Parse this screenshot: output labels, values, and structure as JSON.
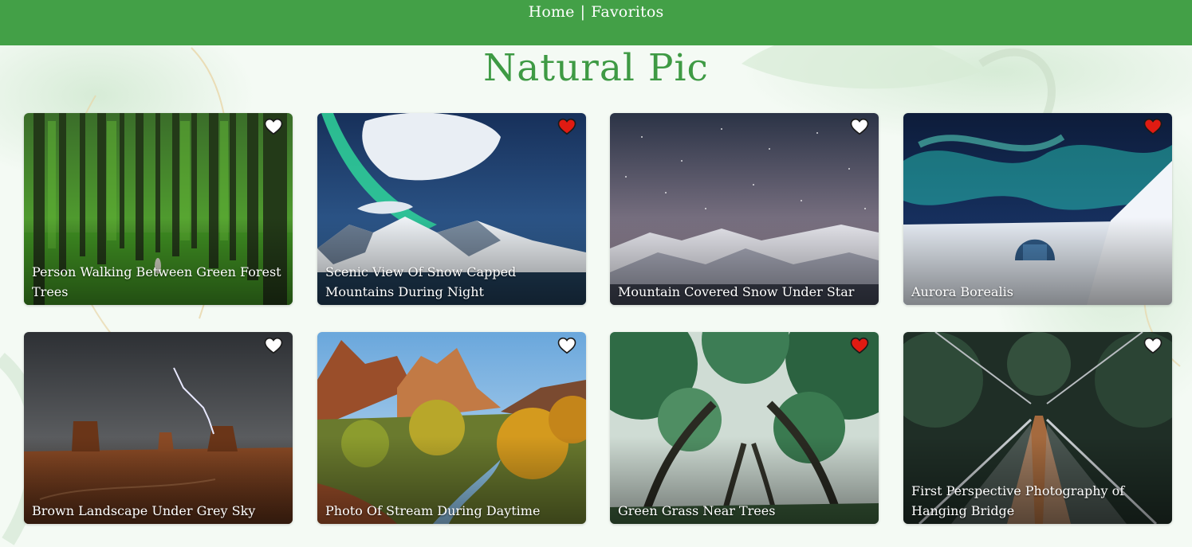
{
  "nav": {
    "home_label": "Home",
    "separator": "|",
    "favorites_label": "Favoritos"
  },
  "page": {
    "title": "Natural Pic"
  },
  "colors": {
    "navbar": "#43a047",
    "title": "#3e9a44",
    "heart_favorite": "#e01b12",
    "heart_default": "#ffffff"
  },
  "cards": [
    {
      "caption": "Person Walking Between Green Forest Trees",
      "favorite": false,
      "scene": "forest"
    },
    {
      "caption": "Scenic View Of Snow Capped Mountains During Night",
      "favorite": true,
      "scene": "aurora-mountains"
    },
    {
      "caption": "Mountain Covered Snow Under Star",
      "favorite": false,
      "scene": "starry-mountains"
    },
    {
      "caption": "Aurora Borealis",
      "favorite": true,
      "scene": "aurora-igloo"
    },
    {
      "caption": "Brown Landscape Under Grey Sky",
      "favorite": false,
      "scene": "desert-storm"
    },
    {
      "caption": "Photo Of Stream During Daytime",
      "favorite": false,
      "scene": "canyon-stream"
    },
    {
      "caption": "Green Grass Near Trees",
      "favorite": true,
      "scene": "tree-canopy"
    },
    {
      "caption": "First Perspective Photography of Hanging Bridge",
      "favorite": false,
      "scene": "hanging-bridge"
    }
  ]
}
